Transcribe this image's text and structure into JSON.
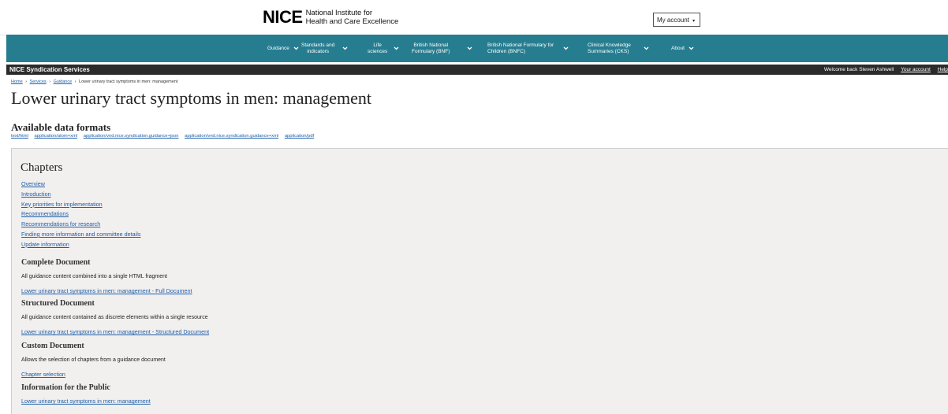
{
  "header": {
    "logo_mark": "NICE",
    "logo_line1": "National Institute for",
    "logo_line2": "Health and Care Excellence",
    "account_label": "My account",
    "account_caret": "▾"
  },
  "nav": {
    "items": [
      {
        "label1": "Guidance",
        "label2": ""
      },
      {
        "label1": "Standards and",
        "label2": "indicators"
      },
      {
        "label1": "Life",
        "label2": "sciences"
      },
      {
        "label1": "British National",
        "label2": "Formulary (BNF)"
      },
      {
        "label1": "British National Formulary for",
        "label2": "Children (BNFC)"
      },
      {
        "label1": "Clinical Knowledge",
        "label2": "Summaries (CKS)"
      },
      {
        "label1": "About",
        "label2": ""
      }
    ]
  },
  "darkbar": {
    "site_name": "NICE Syndication Services",
    "welcome": "Welcome back Steven Ashwell",
    "your_account": "Your account",
    "help": "Help"
  },
  "breadcrumb": {
    "home": "Home",
    "services": "Services",
    "guidance": "Guidance",
    "current": "Lower urinary tract symptoms in men: management",
    "separator": "›"
  },
  "page_title": "Lower urinary tract symptoms in men: management",
  "formats": {
    "heading": "Available data formats",
    "items": [
      "text/html",
      "application/atom+xml",
      "application/vnd.nice.syndication.guidance+json",
      "application/vnd.nice.syndication.guidance+xml",
      "application/pdf"
    ]
  },
  "chapters": {
    "heading": "Chapters",
    "items": [
      "Overview",
      "Introduction",
      "Key priorities for implementation",
      "Recommendations",
      "Recommendations for research",
      "Finding more information and committee details",
      "Update information"
    ]
  },
  "complete": {
    "heading": "Complete Document",
    "desc": "All guidance content combined into a single HTML fragment",
    "link": "Lower urinary tract symptoms in men: management - Full Document"
  },
  "structured": {
    "heading": "Structured Document",
    "desc": "All guidance content contained as discrete elements within a single resource",
    "link": "Lower urinary tract symptoms in men: management - Structured Document"
  },
  "custom": {
    "heading": "Custom Document",
    "desc": "Allows the selection of chapters from a guidance document",
    "link": "Chapter selection"
  },
  "public": {
    "heading": "Information for the Public",
    "link": "Lower urinary tract symptoms in men: management"
  }
}
